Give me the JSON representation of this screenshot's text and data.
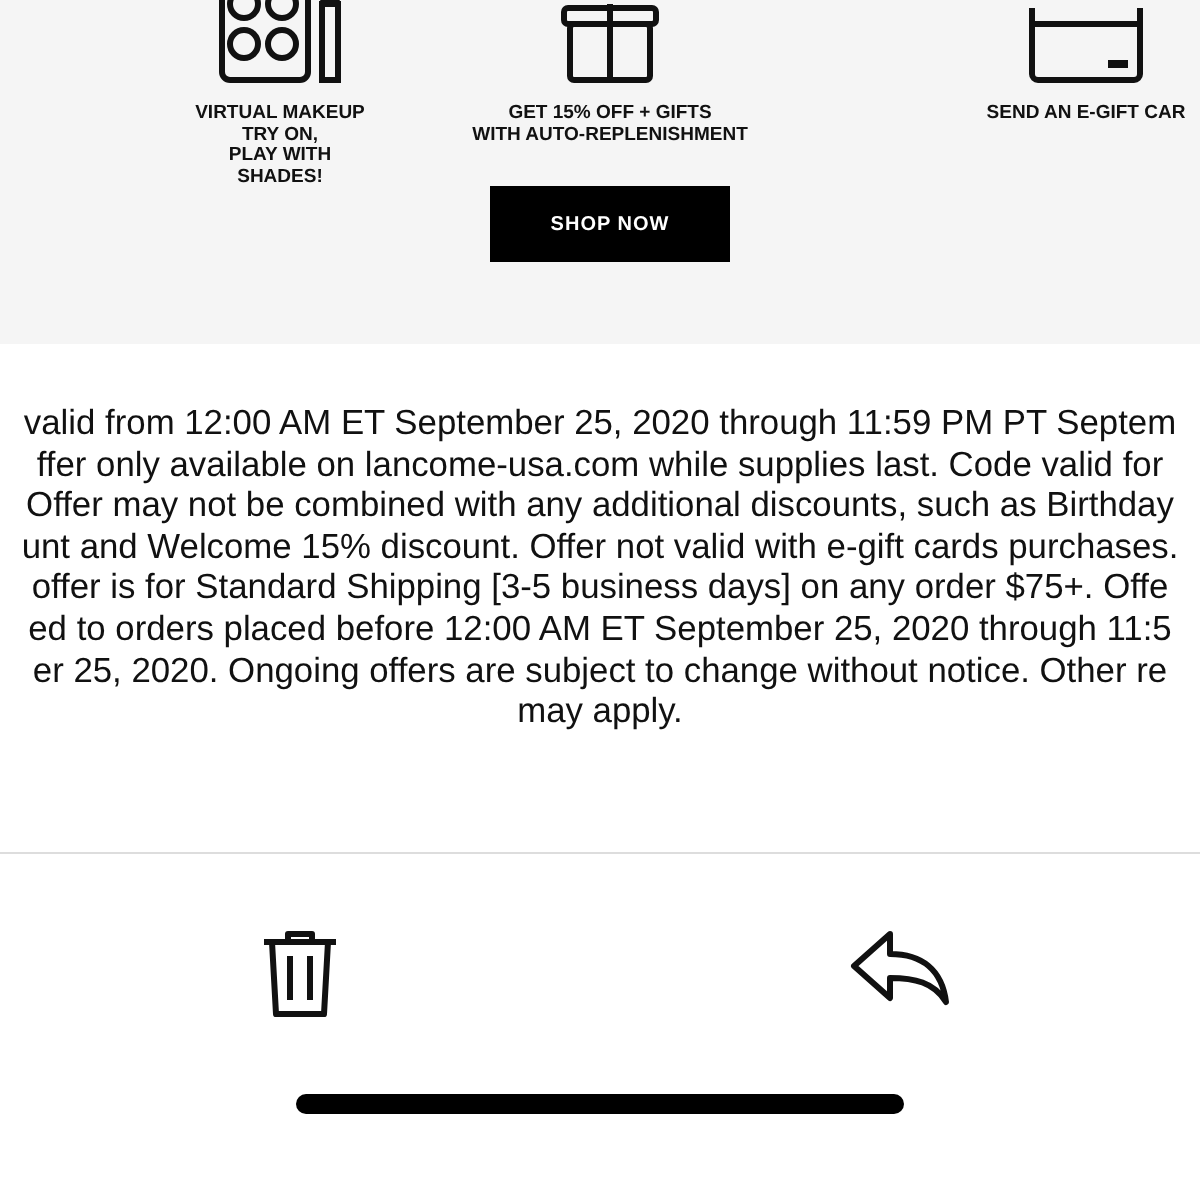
{
  "features": [
    {
      "kind": "makeup",
      "label_lines": [
        "VIRTUAL MAKEUP",
        "TRY ON,",
        "PLAY WITH",
        "SHADES!"
      ]
    },
    {
      "kind": "gift",
      "label_lines": [
        "GET 15% OFF + GIFTS",
        "WITH AUTO-REPLENISHMENT"
      ],
      "button": "SHOP NOW"
    },
    {
      "kind": "card",
      "label_lines": [
        "SEND AN E-GIFT CAR"
      ]
    }
  ],
  "terms_lines": [
    "valid from 12:00 AM ET September 25, 2020 through 11:59 PM PT Septem",
    "ffer only available on lancome-usa.com while supplies last. Code valid for",
    "Offer may not be combined with any additional discounts, such as Birthday",
    "unt and Welcome 15% discount. Offer not valid with e-gift cards purchases.",
    "offer is for Standard Shipping [3-5 business days] on any order $75+. Offe",
    "ed to orders placed before 12:00 AM ET September 25, 2020 through 11:5",
    "er 25, 2020. Ongoing offers are subject to change without notice. Other re",
    "may apply."
  ],
  "toolbar": [
    {
      "kind": "delete"
    },
    {
      "kind": "reply"
    }
  ]
}
